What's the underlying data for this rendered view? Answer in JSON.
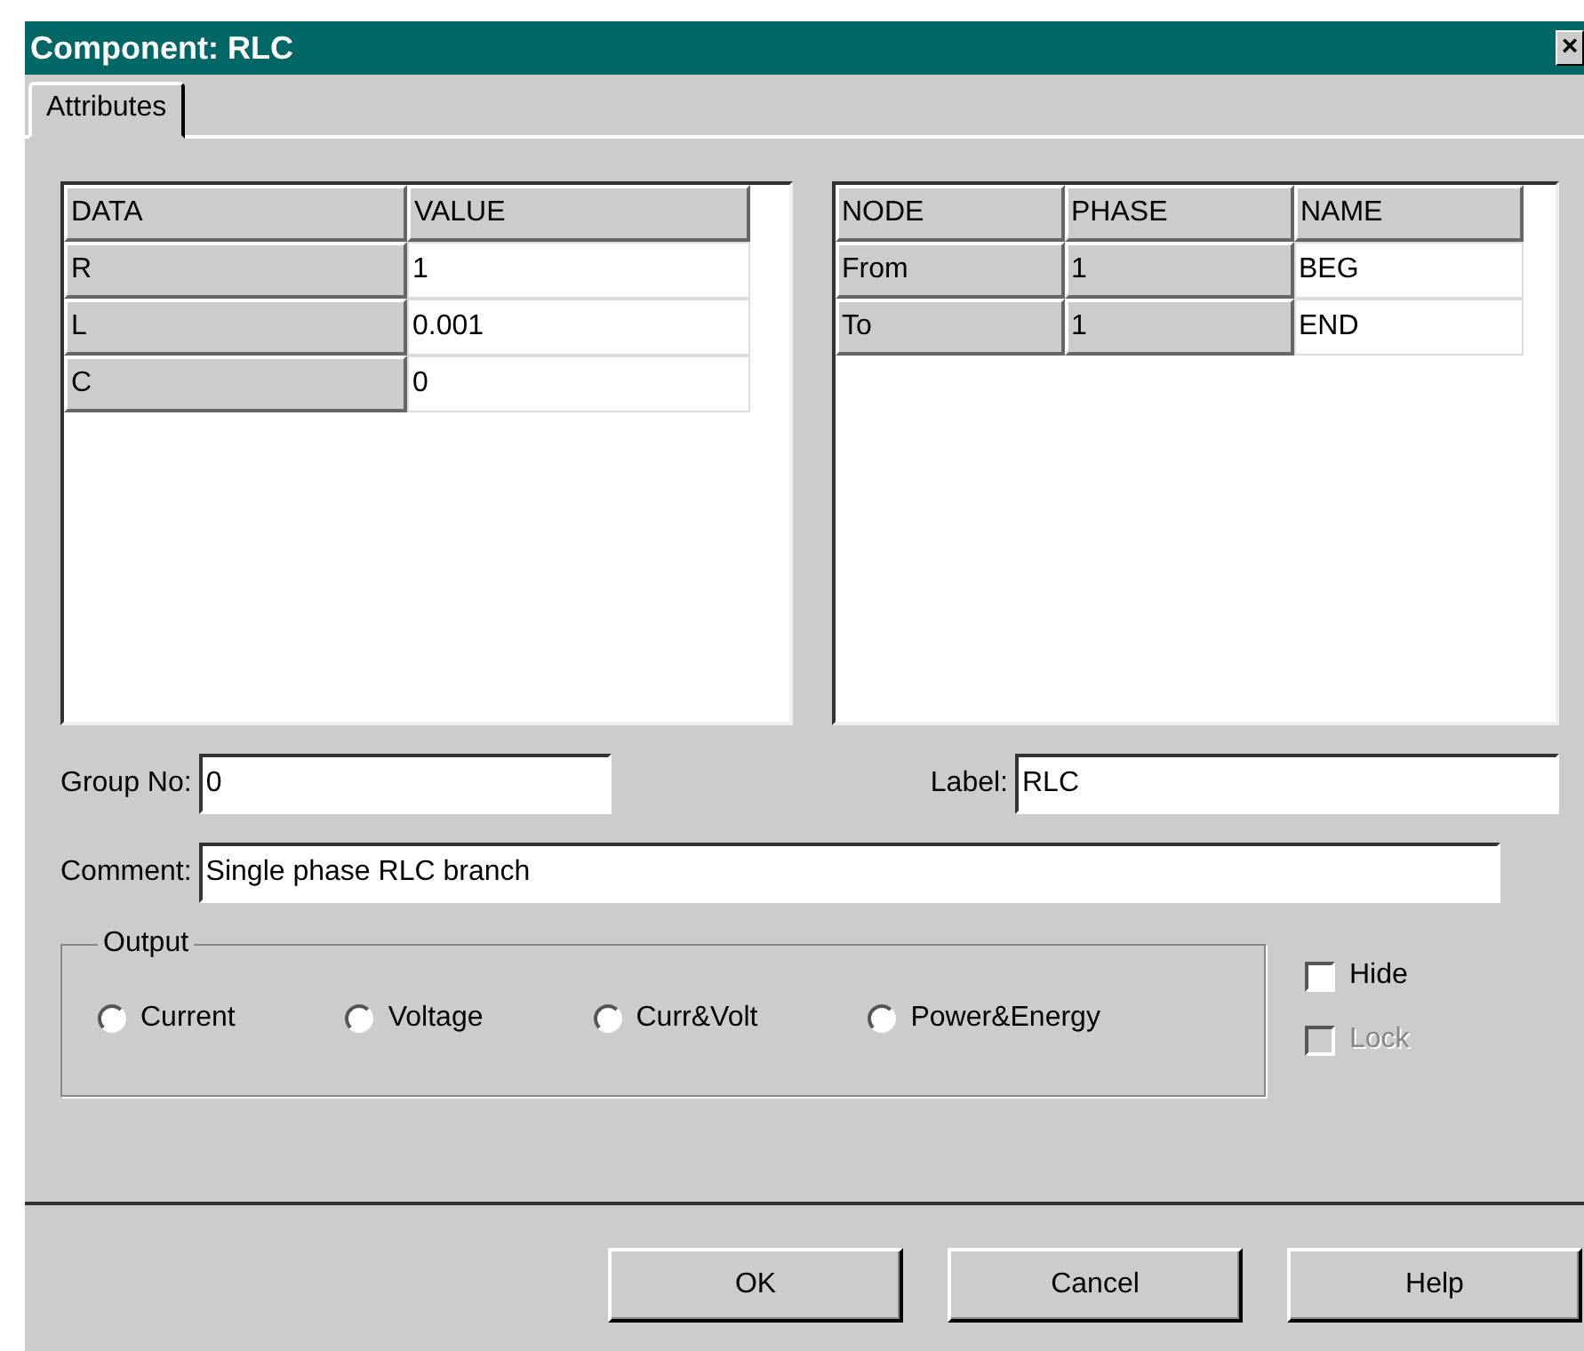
{
  "window": {
    "title": "Component: RLC",
    "close": "×"
  },
  "tabs": [
    {
      "label": "Attributes",
      "selected": true
    }
  ],
  "data_table": {
    "columns": [
      "DATA",
      "VALUE"
    ],
    "rows": [
      [
        {
          "text": "R",
          "editable": false
        },
        {
          "text": "1",
          "editable": true
        }
      ],
      [
        {
          "text": "L",
          "editable": false
        },
        {
          "text": "0.001",
          "editable": true
        }
      ],
      [
        {
          "text": "C",
          "editable": false
        },
        {
          "text": "0",
          "editable": true
        }
      ]
    ]
  },
  "node_table": {
    "columns": [
      "NODE",
      "PHASE",
      "NAME"
    ],
    "rows": [
      [
        {
          "text": "From",
          "editable": false
        },
        {
          "text": "1",
          "editable": false
        },
        {
          "text": "BEG",
          "editable": true
        }
      ],
      [
        {
          "text": "To",
          "editable": false
        },
        {
          "text": "1",
          "editable": false
        },
        {
          "text": "END",
          "editable": true
        }
      ]
    ]
  },
  "group_no": {
    "label": "Group No:",
    "value": "0"
  },
  "label_field": {
    "label": "Label:",
    "value": "RLC"
  },
  "comment": {
    "label": "Comment:",
    "value": "Single phase RLC branch"
  },
  "output": {
    "title": "Output",
    "options": [
      {
        "label": "Current",
        "selected": false
      },
      {
        "label": "Voltage",
        "selected": false
      },
      {
        "label": "Curr&Volt",
        "selected": false
      },
      {
        "label": "Power&Energy",
        "selected": false
      }
    ]
  },
  "checkboxes": [
    {
      "label": "Hide",
      "checked": false,
      "disabled": false
    },
    {
      "label": "Lock",
      "checked": false,
      "disabled": true
    }
  ],
  "buttons": [
    {
      "label": "OK"
    },
    {
      "label": "Cancel"
    },
    {
      "label": "Help"
    }
  ]
}
